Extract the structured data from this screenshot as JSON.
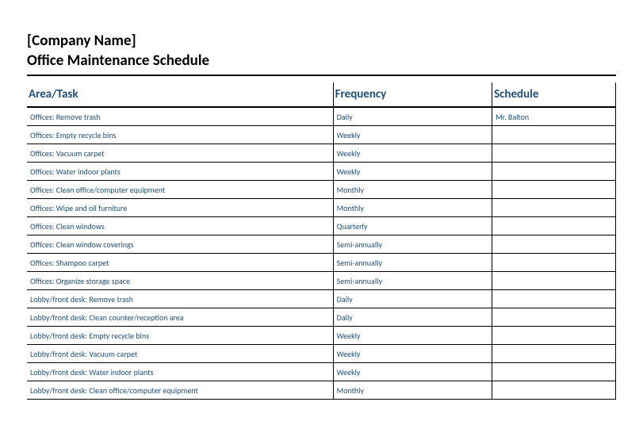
{
  "header": {
    "company": "[Company Name]",
    "title": "Office Maintenance Schedule"
  },
  "columns": {
    "c1": "Area/Task",
    "c2": "Frequency",
    "c3": "Schedule"
  },
  "rows": [
    {
      "task": "Offices: Remove trash",
      "freq": "Daily",
      "sched": "Mr. Balton"
    },
    {
      "task": "Offices: Empty recycle bins",
      "freq": "Weekly",
      "sched": ""
    },
    {
      "task": "Offices: Vacuum carpet",
      "freq": "Weekly",
      "sched": ""
    },
    {
      "task": "Offices: Water indoor plants",
      "freq": "Weekly",
      "sched": ""
    },
    {
      "task": "Offices: Clean office/computer equipment",
      "freq": "Monthly",
      "sched": ""
    },
    {
      "task": "Offices: Wipe and oil furniture",
      "freq": "Monthly",
      "sched": ""
    },
    {
      "task": "Offices: Clean windows",
      "freq": "Quarterly",
      "sched": ""
    },
    {
      "task": "Offices: Clean window coverings",
      "freq": "Semi-annually",
      "sched": ""
    },
    {
      "task": "Offices: Shampoo carpet",
      "freq": "Semi-annually",
      "sched": ""
    },
    {
      "task": "Offices: Organize storage space",
      "freq": "Semi-annually",
      "sched": ""
    },
    {
      "task": "Lobby/front desk: Remove trash",
      "freq": "Daily",
      "sched": ""
    },
    {
      "task": "Lobby/front desk: Clean counter/reception area",
      "freq": "Daily",
      "sched": ""
    },
    {
      "task": "Lobby/front desk: Empty recycle bins",
      "freq": "Weekly",
      "sched": ""
    },
    {
      "task": "Lobby/front desk: Vacuum carpet",
      "freq": "Weekly",
      "sched": ""
    },
    {
      "task": "Lobby/front desk: Water indoor plants",
      "freq": "Weekly",
      "sched": ""
    },
    {
      "task": "Lobby/front desk: Clean office/computer equipment",
      "freq": "Monthly",
      "sched": ""
    }
  ]
}
